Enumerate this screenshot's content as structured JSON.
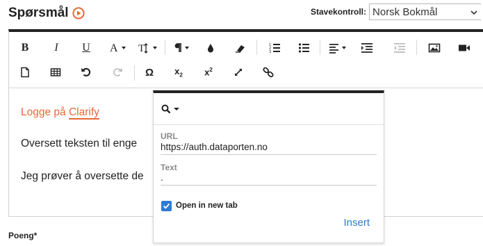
{
  "header": {
    "title": "Spørsmål"
  },
  "spellcheck": {
    "label": "Stavekontroll:",
    "selected": "Norsk Bokmål"
  },
  "toolbar": {
    "bold": "B",
    "italic": "I",
    "underline": "U",
    "special_char": "Ω",
    "subscript_base": "x",
    "subscript_mark": "2",
    "superscript_base": "x",
    "superscript_mark": "2"
  },
  "content": {
    "line1_prefix": "Logge på ",
    "line1_link": "Clarify",
    "line2": "Oversett teksten til enge",
    "line3": "Jeg prøver å oversette de"
  },
  "link_dialog": {
    "url_label": "URL",
    "url_value": "https://auth.dataporten.no",
    "text_label": "Text",
    "text_value": ".",
    "open_new_tab_label": "Open in new tab",
    "open_new_tab_checked": true,
    "insert_label": "Insert"
  },
  "footer": {
    "poeng_label": "Poeng*"
  },
  "colors": {
    "accent_orange": "#e8683a",
    "link_blue": "#2a7bd0",
    "checkbox_blue": "#2d7bd6"
  }
}
